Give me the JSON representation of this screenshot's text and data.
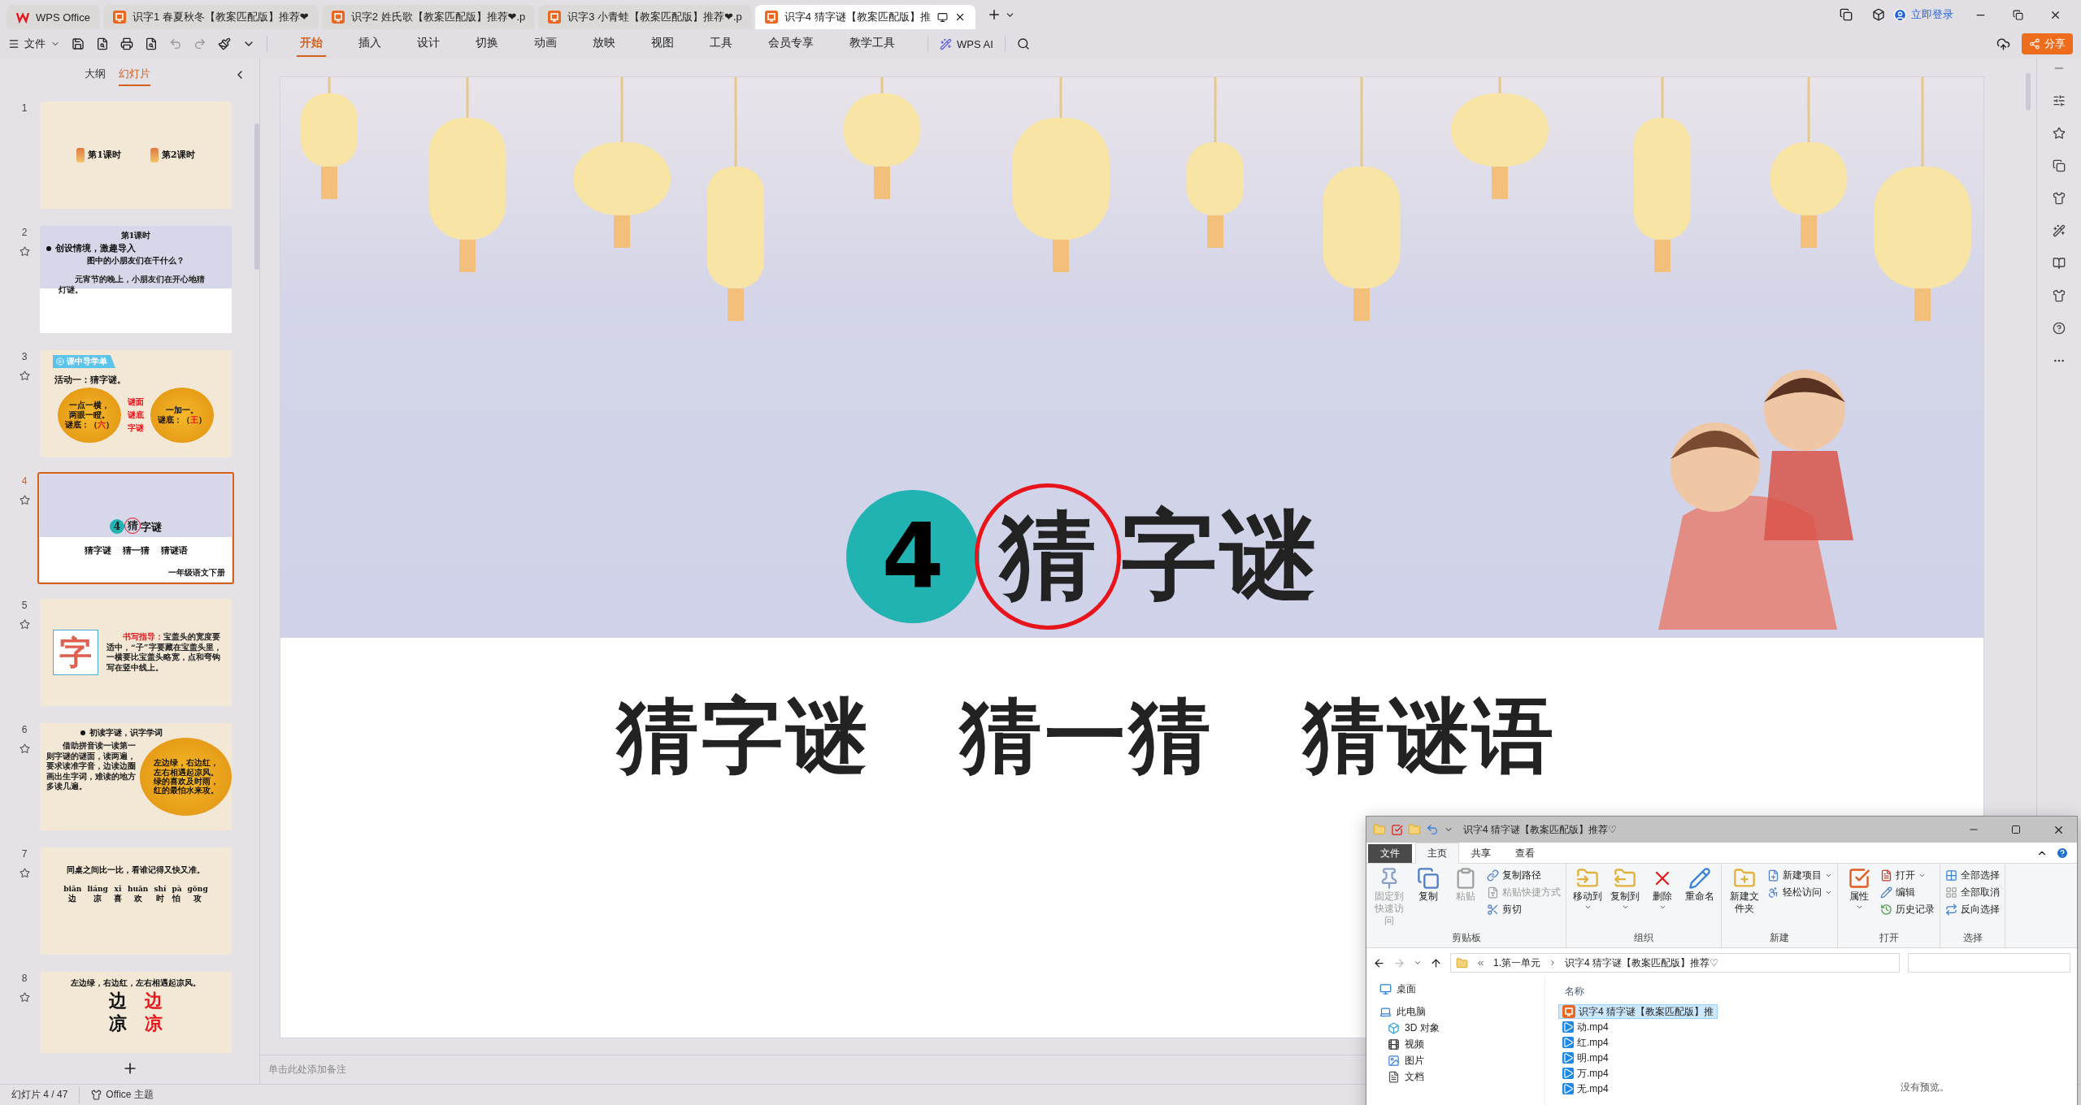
{
  "tabs": [
    {
      "kind": "home",
      "label": "WPS Office",
      "selected": false
    },
    {
      "kind": "doc",
      "label": "识字1 春夏秋冬【教案匹配版】推荐❤",
      "selected": false
    },
    {
      "kind": "doc",
      "label": "识字2 姓氏歌【教案匹配版】推荐❤.p",
      "selected": false
    },
    {
      "kind": "doc",
      "label": "识字3 小青蛙【教案匹配版】推荐❤.p",
      "selected": false
    },
    {
      "kind": "doc",
      "label": "识字4 猜字谜【教案匹配版】推",
      "selected": true
    }
  ],
  "account": {
    "label": "立即登录"
  },
  "menu_button": "文件",
  "ribbon_tabs": [
    {
      "label": "开始",
      "selected": true
    },
    {
      "label": "插入",
      "selected": false
    },
    {
      "label": "设计",
      "selected": false
    },
    {
      "label": "切换",
      "selected": false
    },
    {
      "label": "动画",
      "selected": false
    },
    {
      "label": "放映",
      "selected": false
    },
    {
      "label": "视图",
      "selected": false
    },
    {
      "label": "工具",
      "selected": false
    },
    {
      "label": "会员专享",
      "selected": false
    },
    {
      "label": "教学工具",
      "selected": false
    }
  ],
  "ai_button": "WPS AI",
  "share_button": "分享",
  "panel_tabs": [
    {
      "label": "大纲",
      "selected": false
    },
    {
      "label": "幻灯片",
      "selected": true
    }
  ],
  "thumbnails": [
    {
      "number": "1",
      "kind": "lessons",
      "selected": false,
      "animated": false,
      "items": [
        "第1课时",
        "第2课时"
      ]
    },
    {
      "number": "2",
      "kind": "intro",
      "selected": false,
      "animated": true,
      "heading": "第1课时",
      "bullet": "创设情境，激趣导入",
      "question": "图中的小朋友们在干什么？",
      "answer": "元宵节的晚上，小朋友们在开心地猜灯谜。"
    },
    {
      "number": "3",
      "kind": "riddle",
      "selected": false,
      "animated": true,
      "badge": "课中导学单",
      "heading": "活动一：猜字谜。",
      "left_lines": [
        "一点一横，",
        "两眼一瞪。"
      ],
      "left_answer": {
        "prefix": "谜底：（",
        "answer": "六",
        "suffix": "）"
      },
      "labels": [
        "谜面",
        "谜底",
        "字谜"
      ],
      "right_lines": [
        "一加一。"
      ],
      "right_answer": {
        "prefix": "谜底：（",
        "answer": "王",
        "suffix": "）"
      }
    },
    {
      "number": "4",
      "kind": "title",
      "selected": true,
      "animated": true,
      "title_number": "4",
      "circled_char": "猜",
      "title_rest": "字谜",
      "subtitle": [
        "猜字谜",
        "猜一猜",
        "猜谜语"
      ],
      "footnote": "一年级语文下册"
    },
    {
      "number": "5",
      "kind": "writing",
      "selected": false,
      "animated": true,
      "character": "字",
      "label": "书写指导：",
      "text": "宝盖头的宽度要适中，“子”字要藏在宝盖头里，一横要比宝盖头略宽，点和弯钩写在竖中线上。"
    },
    {
      "number": "6",
      "kind": "reading",
      "selected": false,
      "animated": true,
      "bullet": "初读字谜，识字学词",
      "text": "借助拼音读一读第一则字谜的谜面，读两遍，要求读准字音，边读边圈画出生字词，难读的地方多读几遍。",
      "lantern_lines": [
        "左边绿，右边红，",
        "左右相遇起凉风。",
        "绿的喜欢及时雨，",
        "红的最怕水来攻。"
      ]
    },
    {
      "number": "7",
      "kind": "pinyin",
      "selected": false,
      "animated": true,
      "heading": "同桌之间比一比，看谁记得又快又准。",
      "words": [
        {
          "pinyin": "biān",
          "char": "边"
        },
        {
          "pinyin": "liáng",
          "char": "凉"
        },
        {
          "pinyin": "xǐ",
          "char": "喜"
        },
        {
          "pinyin": "huān",
          "char": "欢"
        },
        {
          "pinyin": "shí",
          "char": "时"
        },
        {
          "pinyin": "pà",
          "char": "怕"
        },
        {
          "pinyin": "gōng",
          "char": "攻"
        }
      ]
    },
    {
      "number": "8",
      "kind": "compare",
      "selected": false,
      "animated": true,
      "heading": "左边绿，右边红，左右相遇起凉风。",
      "rows": [
        {
          "plain": "边",
          "colored": "边"
        },
        {
          "plain": "凉",
          "colored": "凉"
        }
      ]
    }
  ],
  "slide": {
    "title_number": "4",
    "circled_char": "猜",
    "title_rest": "字谜",
    "subtitle": [
      "猜字谜",
      "猜一猜",
      "猜谜语"
    ]
  },
  "notes_placeholder": "单击此处添加备注",
  "status_bar": {
    "slide_counter": "幻灯片 4 / 47",
    "theme": "Office 主题"
  },
  "explorer": {
    "title": "识字4 猜字谜【教案匹配版】推荐♡",
    "tabs": [
      {
        "label": "文件",
        "kind": "file",
        "selected": false
      },
      {
        "label": "主页",
        "kind": "tab",
        "selected": true
      },
      {
        "label": "共享",
        "kind": "tab",
        "selected": false
      },
      {
        "label": "查看",
        "kind": "tab",
        "selected": false
      }
    ],
    "groups": [
      {
        "name": "剪贴板",
        "large": [
          {
            "label": "固定到快速访问",
            "disabled": true,
            "dropdown": false
          },
          {
            "label": "复制",
            "disabled": false,
            "dropdown": false
          },
          {
            "label": "粘贴",
            "disabled": true,
            "dropdown": false
          }
        ],
        "small": [
          {
            "label": "复制路径",
            "disabled": false,
            "dropdown": false
          },
          {
            "label": "粘贴快捷方式",
            "disabled": true,
            "dropdown": false
          },
          {
            "label": "剪切",
            "disabled": false,
            "dropdown": false
          }
        ]
      },
      {
        "name": "组织",
        "large": [
          {
            "label": "移动到",
            "disabled": false,
            "dropdown": true
          },
          {
            "label": "复制到",
            "disabled": false,
            "dropdown": true
          },
          {
            "label": "删除",
            "disabled": false,
            "dropdown": true
          },
          {
            "label": "重命名",
            "disabled": false,
            "dropdown": false
          }
        ]
      },
      {
        "name": "新建",
        "large": [
          {
            "label": "新建文件夹",
            "disabled": false,
            "dropdown": false
          }
        ],
        "small": [
          {
            "label": "新建项目",
            "disabled": false,
            "dropdown": true
          },
          {
            "label": "轻松访问",
            "disabled": false,
            "dropdown": true
          }
        ]
      },
      {
        "name": "打开",
        "large": [
          {
            "label": "属性",
            "disabled": false,
            "dropdown": true
          }
        ],
        "small": [
          {
            "label": "打开",
            "disabled": false,
            "dropdown": true
          },
          {
            "label": "编辑",
            "disabled": false,
            "dropdown": false
          },
          {
            "label": "历史记录",
            "disabled": false,
            "dropdown": false
          }
        ]
      },
      {
        "name": "选择",
        "small": [
          {
            "label": "全部选择",
            "disabled": false,
            "dropdown": false
          },
          {
            "label": "全部取消",
            "disabled": false,
            "dropdown": false
          },
          {
            "label": "反向选择",
            "disabled": false,
            "dropdown": false
          }
        ]
      }
    ],
    "address": [
      "1.第一单元",
      "识字4 猜字谜【教案匹配版】推荐♡"
    ],
    "nav": [
      {
        "label": "桌面"
      },
      {
        "label": "此电脑",
        "children": [
          {
            "label": "3D 对象"
          },
          {
            "label": "视频"
          },
          {
            "label": "图片"
          },
          {
            "label": "文档"
          }
        ]
      }
    ],
    "column": "名称",
    "files": [
      {
        "name": "识字4 猜字谜【教案匹配版】推",
        "kind": "presentation",
        "selected": true
      },
      {
        "name": "动.mp4",
        "kind": "video",
        "selected": false
      },
      {
        "name": "红.mp4",
        "kind": "video",
        "selected": false
      },
      {
        "name": "明.mp4",
        "kind": "video",
        "selected": false
      },
      {
        "name": "万.mp4",
        "kind": "video",
        "selected": false
      },
      {
        "name": "无.mp4",
        "kind": "video",
        "selected": false
      }
    ],
    "preview": "没有预览。"
  }
}
